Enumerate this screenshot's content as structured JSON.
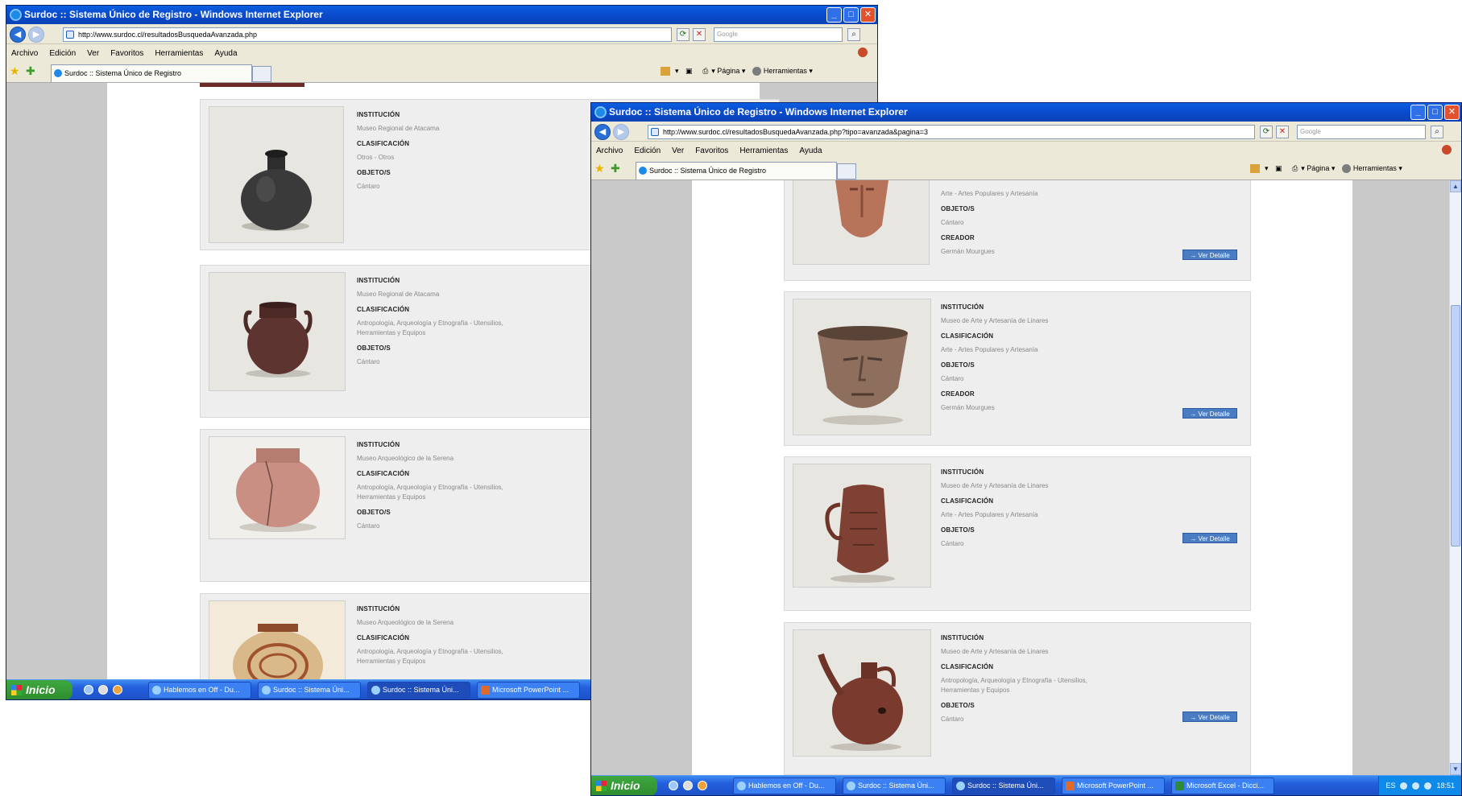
{
  "window_back": {
    "title": "Surdoc :: Sistema Único de Registro - Windows Internet Explorer",
    "address": "http://www.surdoc.cl/resultadosBusquedaAvanzada.php",
    "search_placeholder": "Google",
    "menu": [
      "Archivo",
      "Edición",
      "Ver",
      "Favoritos",
      "Herramientas",
      "Ayuda"
    ],
    "tab_label": "Surdoc :: Sistema Único de Registro",
    "tools": {
      "page": "Página",
      "tools": "Herramientas"
    },
    "results": [
      {
        "labels": [
          "INSTITUCIÓN",
          "CLASIFICACIÓN",
          "OBJETO/S"
        ],
        "institucion": "Museo Regional de Atacama",
        "clasificacion": "Otros - Otros",
        "objeto": "Cántaro"
      },
      {
        "labels": [
          "INSTITUCIÓN",
          "CLASIFICACIÓN",
          "OBJETO/S"
        ],
        "institucion": "Museo Regional de Atacama",
        "clasificacion": "Antropología, Arqueología y Etnografía - Utensilios, Herramientas y Equipos",
        "objeto": "Cántaro"
      },
      {
        "labels": [
          "INSTITUCIÓN",
          "CLASIFICACIÓN",
          "OBJETO/S"
        ],
        "institucion": "Museo Arqueológico de la Serena",
        "clasificacion": "Antropología, Arqueología y Etnografía - Utensilios, Herramientas y Equipos",
        "objeto": "Cántaro"
      },
      {
        "labels": [
          "INSTITUCIÓN",
          "CLASIFICACIÓN"
        ],
        "institucion": "Museo Arqueológico de la Serena",
        "clasificacion": "Antropología, Arqueología y Etnografía - Utensilios, Herramientas y Equipos"
      }
    ],
    "taskbar": {
      "start": "Inicio",
      "items": [
        "Hablemos en Off - Du...",
        "Surdoc :: Sistema Úni...",
        "Surdoc :: Sistema Úni...",
        "Microsoft PowerPoint ..."
      ]
    }
  },
  "window_front": {
    "title": "Surdoc :: Sistema Único de Registro - Windows Internet Explorer",
    "address": "http://www.surdoc.cl/resultadosBusquedaAvanzada.php?tipo=avanzada&pagina=3",
    "search_placeholder": "Google",
    "menu": [
      "Archivo",
      "Edición",
      "Ver",
      "Favoritos",
      "Herramientas",
      "Ayuda"
    ],
    "tab_label": "Surdoc :: Sistema Único de Registro",
    "tools": {
      "page": "Página",
      "tools": "Herramientas"
    },
    "results": [
      {
        "clasificacion": "Arte - Artes Populares y Artesanía",
        "objeto": "Cántaro",
        "creador": "Germán Mourgues",
        "labels": [
          "OBJETO/S",
          "CREADOR"
        ]
      },
      {
        "institucion": "Museo de Arte y Artesanía de Linares",
        "clasificacion": "Arte - Artes Populares y Artesanía",
        "objeto": "Cántaro",
        "creador": "Germán Mourgues",
        "labels": [
          "INSTITUCIÓN",
          "CLASIFICACIÓN",
          "OBJETO/S",
          "CREADOR"
        ]
      },
      {
        "institucion": "Museo de Arte y Artesanía de Linares",
        "clasificacion": "Arte - Artes Populares y Artesanía",
        "objeto": "Cántaro",
        "labels": [
          "INSTITUCIÓN",
          "CLASIFICACIÓN",
          "OBJETO/S"
        ]
      },
      {
        "institucion": "Museo de Arte y Artesanía de Linares",
        "clasificacion": "Antropología, Arqueología y Etnografía - Utensilios, Herramientas y Equipos",
        "objeto": "Cántaro",
        "labels": [
          "INSTITUCIÓN",
          "CLASIFICACIÓN",
          "OBJETO/S"
        ]
      }
    ],
    "ver_detalle": "→ Ver Detalle",
    "taskbar": {
      "start": "Inicio",
      "items": [
        "Hablemos en Off - Du...",
        "Surdoc :: Sistema Úni...",
        "Surdoc :: Sistema Úni...",
        "Microsoft PowerPoint ...",
        "Microsoft Excel - Dicci..."
      ],
      "lang": "ES",
      "clock": "18:51"
    }
  },
  "colors": {
    "titlebar": "#0a4ccf",
    "taskbar": "#245edb",
    "start": "#2e8c2e",
    "ver_detalle": "#4a7cc4"
  },
  "icons": [
    "back-icon",
    "forward-icon",
    "refresh-icon",
    "stop-icon",
    "search-icon",
    "home-icon",
    "feed-icon",
    "print-icon",
    "page-icon",
    "tools-icon",
    "favorites-star-icon",
    "add-favorites-icon"
  ]
}
